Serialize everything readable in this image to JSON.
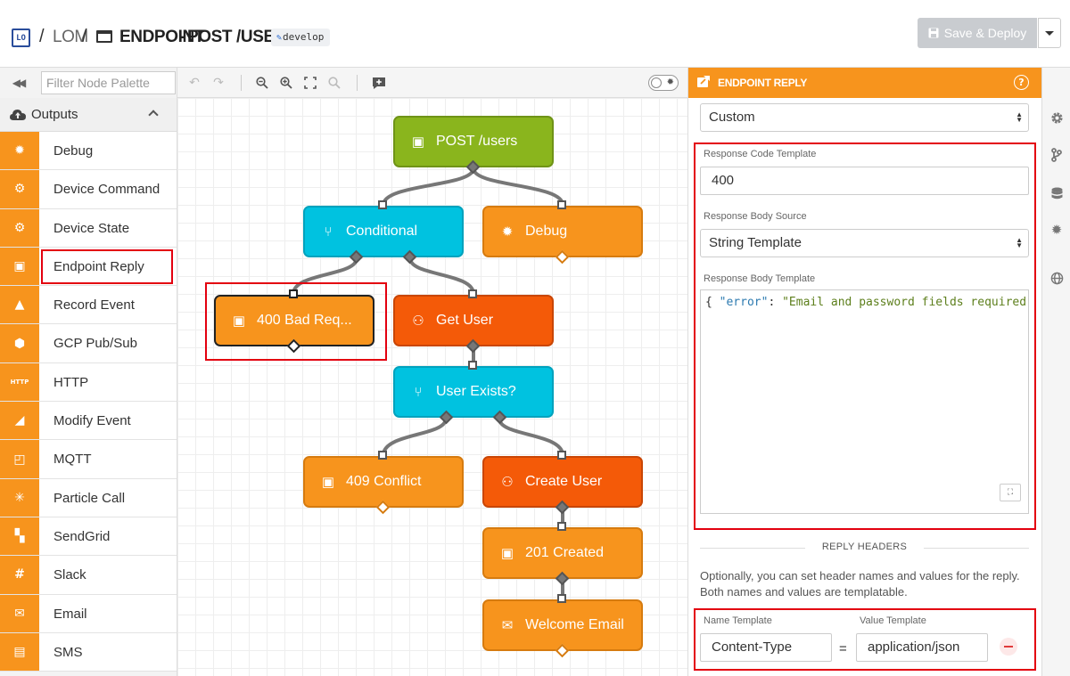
{
  "header": {
    "logo_text": "LO",
    "crumb_app": "LOM",
    "crumb_workflow": "ENDPOINT",
    "crumb_route": "POST /USERS",
    "branch": "develop",
    "save_label": "Save & Deploy",
    "colors": {
      "brand": "#2a4d9b",
      "save_disabled": "#c9ccd0"
    }
  },
  "palette": {
    "filter_placeholder": "Filter Node Palette",
    "category": "Outputs",
    "accent": "#f7941d",
    "items": [
      {
        "label": "Debug",
        "icon": "bug-icon",
        "glyph": "✹"
      },
      {
        "label": "Device Command",
        "icon": "device-command-icon",
        "glyph": "⚙"
      },
      {
        "label": "Device State",
        "icon": "device-state-icon",
        "glyph": "⚙"
      },
      {
        "label": "Endpoint Reply",
        "icon": "endpoint-reply-icon",
        "glyph": "▣"
      },
      {
        "label": "Record Event",
        "icon": "record-event-icon",
        "glyph": "▲"
      },
      {
        "label": "GCP Pub/Sub",
        "icon": "gcp-icon",
        "glyph": "⬢"
      },
      {
        "label": "HTTP",
        "icon": "http-icon",
        "glyph": "HTTP"
      },
      {
        "label": "Modify Event",
        "icon": "modify-event-icon",
        "glyph": "◢"
      },
      {
        "label": "MQTT",
        "icon": "mqtt-icon",
        "glyph": "◰"
      },
      {
        "label": "Particle Call",
        "icon": "particle-icon",
        "glyph": "✳"
      },
      {
        "label": "SendGrid",
        "icon": "sendgrid-icon",
        "glyph": "▚"
      },
      {
        "label": "Slack",
        "icon": "slack-icon",
        "glyph": "#"
      },
      {
        "label": "Email",
        "icon": "envelope-icon",
        "glyph": "✉"
      },
      {
        "label": "SMS",
        "icon": "sms-icon",
        "glyph": "▤"
      }
    ]
  },
  "canvas": {
    "nodes": [
      {
        "id": "post-users",
        "label": "POST /users",
        "color": "green",
        "icon": "endpoint-trigger-icon",
        "glyph": "▣"
      },
      {
        "id": "conditional",
        "label": "Conditional",
        "color": "cyan",
        "icon": "branch-icon",
        "glyph": "⑂"
      },
      {
        "id": "debug",
        "label": "Debug",
        "color": "orange",
        "icon": "bug-icon",
        "glyph": "✹"
      },
      {
        "id": "bad-request",
        "label": "400 Bad Req...",
        "color": "orange",
        "icon": "endpoint-reply-icon",
        "glyph": "▣"
      },
      {
        "id": "get-user",
        "label": "Get User",
        "color": "red",
        "icon": "user-icon",
        "glyph": "⚇"
      },
      {
        "id": "user-exists",
        "label": "User Exists?",
        "color": "cyan",
        "icon": "branch-icon",
        "glyph": "⑂"
      },
      {
        "id": "conflict",
        "label": "409 Conflict",
        "color": "orange",
        "icon": "endpoint-reply-icon",
        "glyph": "▣"
      },
      {
        "id": "create-user",
        "label": "Create User",
        "color": "red",
        "icon": "add-user-icon",
        "glyph": "⚇"
      },
      {
        "id": "created",
        "label": "201 Created",
        "color": "orange",
        "icon": "endpoint-reply-icon",
        "glyph": "▣"
      },
      {
        "id": "welcome-email",
        "label": "Welcome Email",
        "color": "orange",
        "icon": "envelope-icon",
        "glyph": "✉"
      }
    ]
  },
  "panel": {
    "title": "ENDPOINT REPLY",
    "mode": "Custom",
    "response_code_label": "Response Code Template",
    "response_code_value": "400",
    "body_source_label": "Response Body Source",
    "body_source_value": "String Template",
    "body_template_label": "Response Body Template",
    "body_code": {
      "open": "{ ",
      "key": "\"error\"",
      "colon": ": ",
      "value": "\"Email and password fields required\""
    },
    "reply_headers_title": "REPLY HEADERS",
    "reply_headers_desc": "Optionally, you can set header names and values for the reply. Both names and values are templatable.",
    "name_template_label": "Name Template",
    "value_template_label": "Value Template",
    "header_name": "Content-Type",
    "equals": "=",
    "header_value": "application/json",
    "colors": {
      "header": "#f7941d",
      "highlight": "#e3000f"
    }
  }
}
